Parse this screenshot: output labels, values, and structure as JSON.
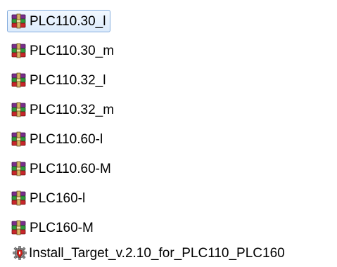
{
  "files": [
    {
      "name": "PLC110.30_l",
      "icon": "winrar-archive-icon",
      "selected": true
    },
    {
      "name": "PLC110.30_m",
      "icon": "winrar-archive-icon",
      "selected": false
    },
    {
      "name": "PLC110.32_l",
      "icon": "winrar-archive-icon",
      "selected": false
    },
    {
      "name": "PLC110.32_m",
      "icon": "winrar-archive-icon",
      "selected": false
    },
    {
      "name": "PLC110.60-l",
      "icon": "winrar-archive-icon",
      "selected": false
    },
    {
      "name": "PLC110.60-M",
      "icon": "winrar-archive-icon",
      "selected": false
    },
    {
      "name": "PLC160-l",
      "icon": "winrar-archive-icon",
      "selected": false
    },
    {
      "name": "PLC160-M",
      "icon": "winrar-archive-icon",
      "selected": false
    },
    {
      "name": "Install_Target_v.2.10_for_PLC110_PLC160",
      "icon": "installer-gear-icon",
      "selected": false
    }
  ],
  "colors": {
    "selection_fill": "#dcebfc",
    "selection_border": "#84acdd",
    "archive_purple": "#7a2d8c",
    "archive_green": "#2e9a3a",
    "archive_red": "#c8262a",
    "installer_red": "#d0201a"
  }
}
